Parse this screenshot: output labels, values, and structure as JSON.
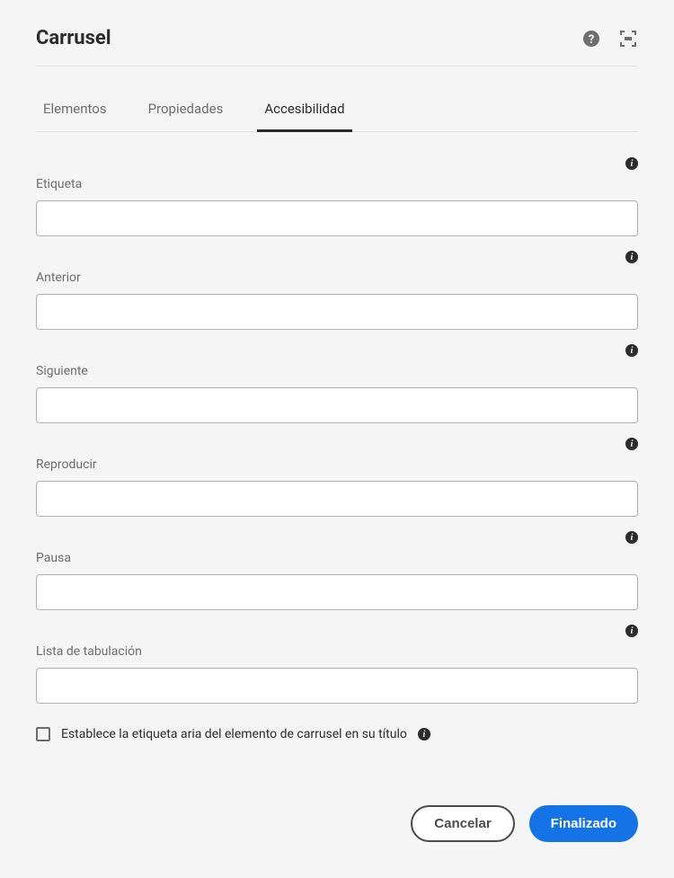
{
  "dialog": {
    "title": "Carrusel"
  },
  "tabs": [
    {
      "label": "Elementos"
    },
    {
      "label": "Propiedades"
    },
    {
      "label": "Accesibilidad"
    }
  ],
  "activeTab": 2,
  "fields": {
    "etiqueta": {
      "label": "Etiqueta",
      "value": ""
    },
    "anterior": {
      "label": "Anterior",
      "value": ""
    },
    "siguiente": {
      "label": "Siguiente",
      "value": ""
    },
    "reproducir": {
      "label": "Reproducir",
      "value": ""
    },
    "pausa": {
      "label": "Pausa",
      "value": ""
    },
    "listaTabulacion": {
      "label": "Lista de tabulación",
      "value": ""
    }
  },
  "checkbox": {
    "label": "Establece la etiqueta aria del elemento de carrusel en su título",
    "checked": false
  },
  "buttons": {
    "cancel": "Cancelar",
    "done": "Finalizado"
  }
}
